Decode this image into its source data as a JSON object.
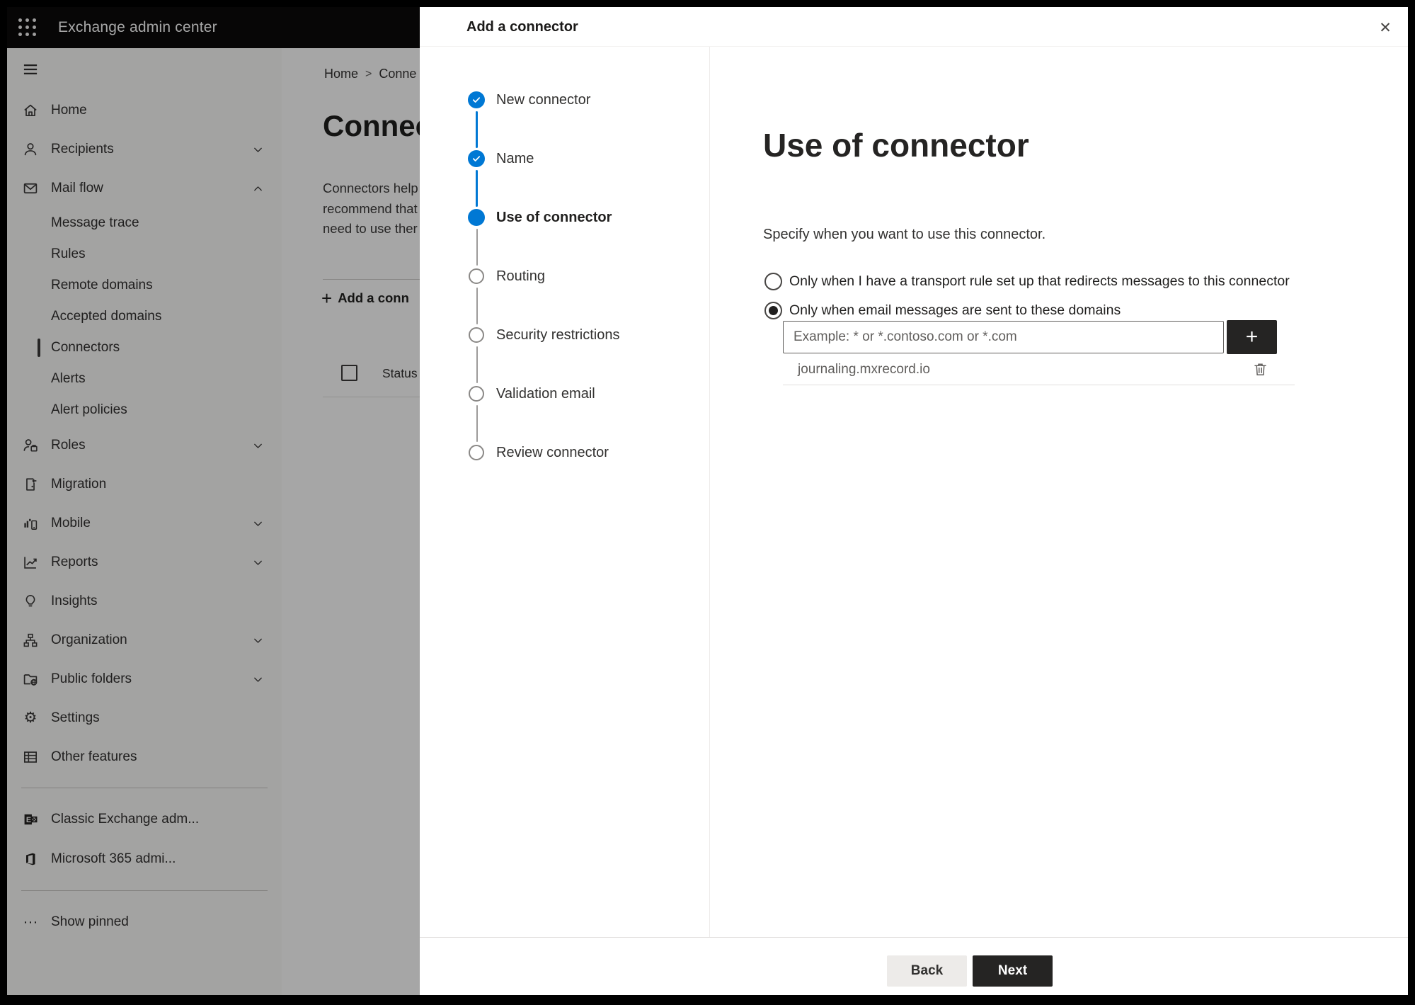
{
  "topbar": {
    "app_title": "Exchange admin center"
  },
  "sidebar": {
    "items": [
      {
        "type": "top",
        "label": "Home",
        "icon": "home-icon"
      },
      {
        "type": "top",
        "label": "Recipients",
        "icon": "person-icon",
        "chevron": "down"
      },
      {
        "type": "top",
        "label": "Mail flow",
        "icon": "mail-icon",
        "chevron": "up"
      },
      {
        "type": "sub",
        "label": "Message trace"
      },
      {
        "type": "sub",
        "label": "Rules"
      },
      {
        "type": "sub",
        "label": "Remote domains"
      },
      {
        "type": "sub",
        "label": "Accepted domains"
      },
      {
        "type": "sub",
        "label": "Connectors",
        "selected": true
      },
      {
        "type": "sub",
        "label": "Alerts"
      },
      {
        "type": "sub",
        "label": "Alert policies"
      },
      {
        "type": "top",
        "label": "Roles",
        "icon": "roles-icon",
        "chevron": "down"
      },
      {
        "type": "top",
        "label": "Migration",
        "icon": "migration-icon"
      },
      {
        "type": "top",
        "label": "Mobile",
        "icon": "mobile-icon",
        "chevron": "down"
      },
      {
        "type": "top",
        "label": "Reports",
        "icon": "reports-icon",
        "chevron": "down"
      },
      {
        "type": "top",
        "label": "Insights",
        "icon": "insights-icon"
      },
      {
        "type": "top",
        "label": "Organization",
        "icon": "organization-icon",
        "chevron": "down"
      },
      {
        "type": "top",
        "label": "Public folders",
        "icon": "public-folders-icon",
        "chevron": "down"
      },
      {
        "type": "top",
        "label": "Settings",
        "icon": "settings-icon"
      },
      {
        "type": "top",
        "label": "Other features",
        "icon": "other-features-icon"
      },
      {
        "type": "divider"
      },
      {
        "type": "top",
        "label": "Classic Exchange adm...",
        "icon": "classic-exchange-icon",
        "tall": true
      },
      {
        "type": "top",
        "label": "Microsoft 365 admi...",
        "icon": "m365-icon",
        "tall": true
      },
      {
        "type": "divider"
      },
      {
        "type": "top",
        "label": "Show pinned",
        "icon": "ellipsis-icon"
      }
    ]
  },
  "page": {
    "breadcrumb": {
      "items": [
        "Home",
        "Conne"
      ],
      "separator": ">"
    },
    "title": "Connect",
    "description_lines": [
      "Connectors help",
      "recommend that",
      "need to use ther"
    ],
    "add_button_label": "Add a conn",
    "table": {
      "status_header": "Status"
    }
  },
  "modal": {
    "title": "Add a connector",
    "steps": [
      {
        "label": "New connector",
        "state": "completed"
      },
      {
        "label": "Name",
        "state": "completed"
      },
      {
        "label": "Use of connector",
        "state": "current"
      },
      {
        "label": "Routing",
        "state": "upcoming"
      },
      {
        "label": "Security restrictions",
        "state": "upcoming"
      },
      {
        "label": "Validation email",
        "state": "upcoming"
      },
      {
        "label": "Review connector",
        "state": "upcoming"
      }
    ],
    "content": {
      "heading": "Use of connector",
      "subtext": "Specify when you want to use this connector.",
      "options": [
        {
          "label": "Only when I have a transport rule set up that redirects messages to this connector",
          "selected": false
        },
        {
          "label": "Only when email messages are sent to these domains",
          "selected": true
        }
      ],
      "domain_input_placeholder": "Example: * or *.contoso.com or *.com",
      "domains": [
        "journaling.mxrecord.io"
      ]
    },
    "footer": {
      "back_label": "Back",
      "next_label": "Next"
    }
  },
  "icons": {
    "close-icon": "✕",
    "plus-icon": "+",
    "add-icon": "+",
    "settings-icon": "⚙",
    "ellipsis-icon": "···",
    "breadcrumb-separator-icon": ">"
  },
  "colors": {
    "accent": "#0078d4",
    "dark_button": "#252423",
    "step_gray": "#8a8886"
  }
}
